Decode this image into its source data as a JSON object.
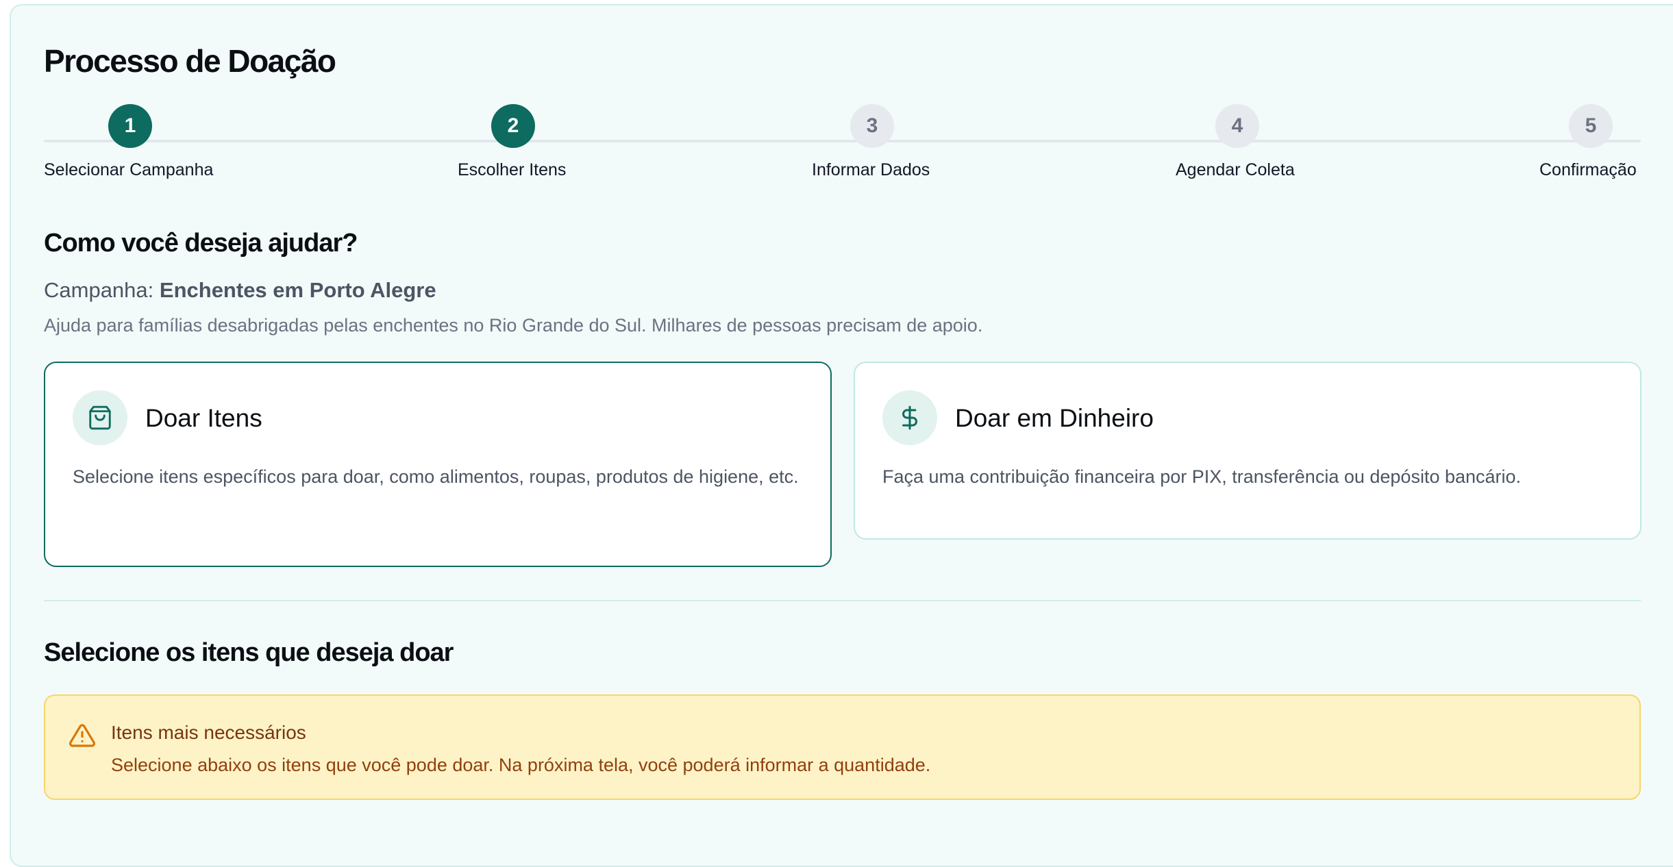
{
  "page": {
    "title": "Processo de Doação"
  },
  "stepper": {
    "steps": [
      {
        "number": "1",
        "label": "Selecionar Campanha",
        "state": "active"
      },
      {
        "number": "2",
        "label": "Escolher Itens",
        "state": "active"
      },
      {
        "number": "3",
        "label": "Informar Dados",
        "state": "inactive"
      },
      {
        "number": "4",
        "label": "Agendar Coleta",
        "state": "inactive"
      },
      {
        "number": "5",
        "label": "Confirmação",
        "state": "inactive"
      }
    ]
  },
  "help_section": {
    "title": "Como você deseja ajudar?",
    "campaign_prefix": "Campanha:",
    "campaign_name": "Enchentes em Porto Alegre",
    "campaign_description": "Ajuda para famílias desabrigadas pelas enchentes no Rio Grande do Sul. Milhares de pessoas precisam de apoio."
  },
  "options": [
    {
      "icon": "shopping-bag-icon",
      "title": "Doar Itens",
      "description": "Selecione itens específicos para doar, como alimentos, roupas, produtos de higiene, etc.",
      "selected": true
    },
    {
      "icon": "dollar-icon",
      "title": "Doar em Dinheiro",
      "description": "Faça uma contribuição financeira por PIX, transferência ou depósito bancário.",
      "selected": false
    }
  ],
  "items_section": {
    "title": "Selecione os itens que deseja doar",
    "alert": {
      "icon": "warning-triangle-icon",
      "title": "Itens mais necessários",
      "text": "Selecione abaixo os itens que você pode doar. Na próxima tela, você poderá informar a quantidade."
    }
  },
  "colors": {
    "primary": "#0d6b5f",
    "panel_background": "#f3fafa",
    "alert_background": "#fef3c7",
    "alert_border": "#f6d66a",
    "inactive_step": "#e6e9ee"
  }
}
